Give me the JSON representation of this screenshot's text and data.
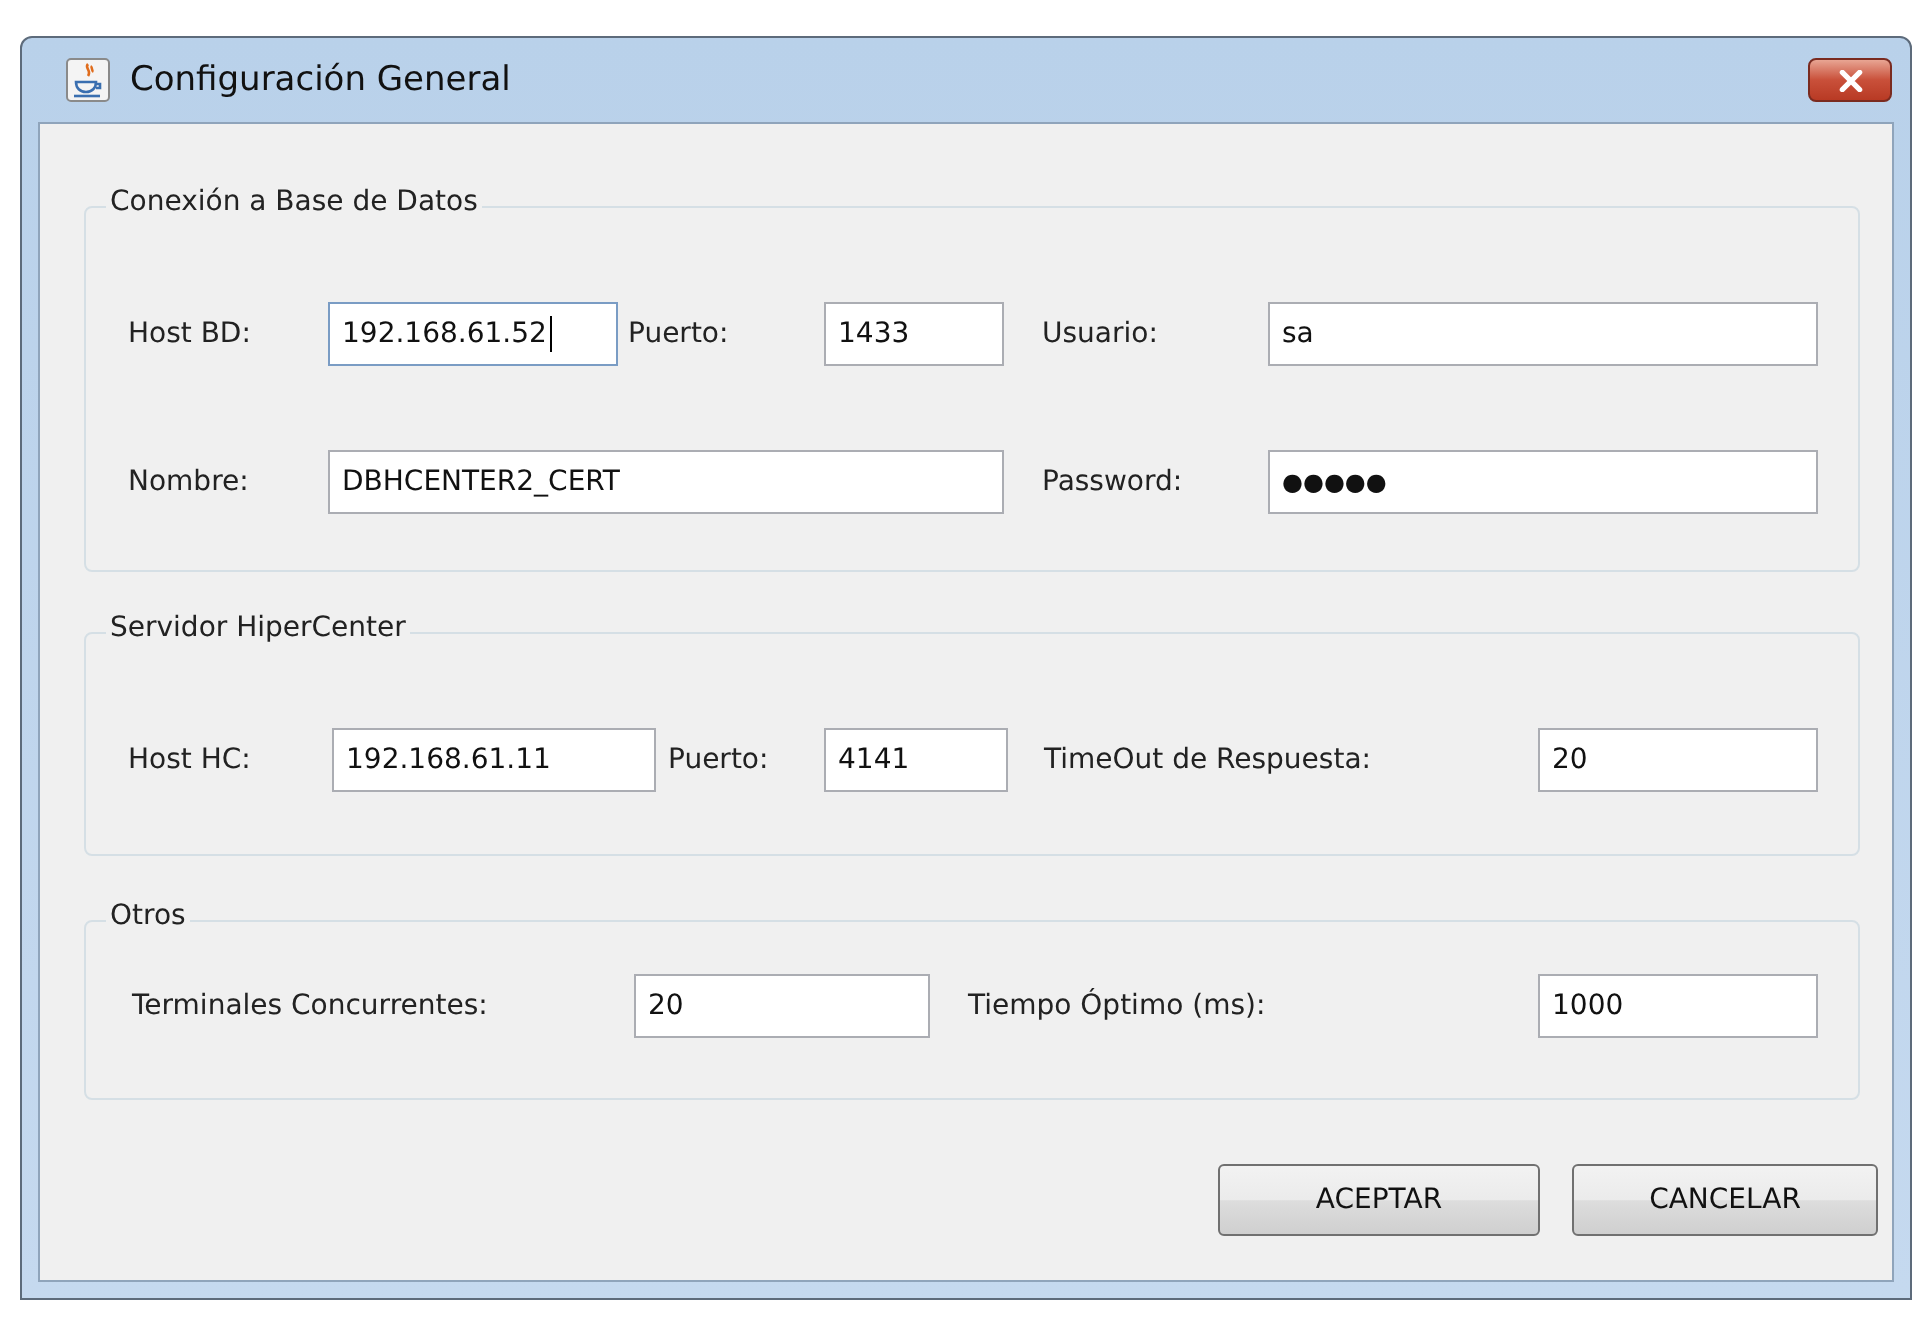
{
  "window": {
    "title": "Configuración General"
  },
  "groups": [
    {
      "title": "Conexión a Base de Datos",
      "left": [
        [
          {
            "label": "Host BD:",
            "kind": "text",
            "value": "192.168.61.52",
            "focused": true
          },
          {
            "label": "Puerto:",
            "kind": "text",
            "value": "1433",
            "focused": false
          }
        ],
        [
          {
            "label": "Nombre:",
            "kind": "text",
            "value": "DBHCENTER2_CERT",
            "focused": false
          }
        ]
      ],
      "right": [
        [
          {
            "label": "Usuario:",
            "kind": "text",
            "value": "sa",
            "focused": false
          }
        ],
        [
          {
            "label": "Password:",
            "kind": "password",
            "value": "●●●●●",
            "focused": false
          }
        ]
      ]
    },
    {
      "title": "Servidor HiperCenter",
      "left": [
        [
          {
            "label": "Host HC:",
            "kind": "text",
            "value": "192.168.61.11",
            "focused": false
          },
          {
            "label": "Puerto:",
            "kind": "text",
            "value": "4141",
            "focused": false
          }
        ]
      ],
      "right": [
        [
          {
            "label": "TimeOut de Respuesta:",
            "kind": "text",
            "value": "20",
            "focused": false
          }
        ]
      ]
    },
    {
      "title": "Otros",
      "left": [
        [
          {
            "label": "Terminales Concurrentes:",
            "kind": "text",
            "value": "20",
            "focused": false
          }
        ]
      ],
      "right": [
        [
          {
            "label": "Tiempo Óptimo (ms):",
            "kind": "text",
            "value": "1000",
            "focused": false
          }
        ]
      ]
    }
  ],
  "buttons": [
    "ACEPTAR",
    "CANCELAR"
  ]
}
